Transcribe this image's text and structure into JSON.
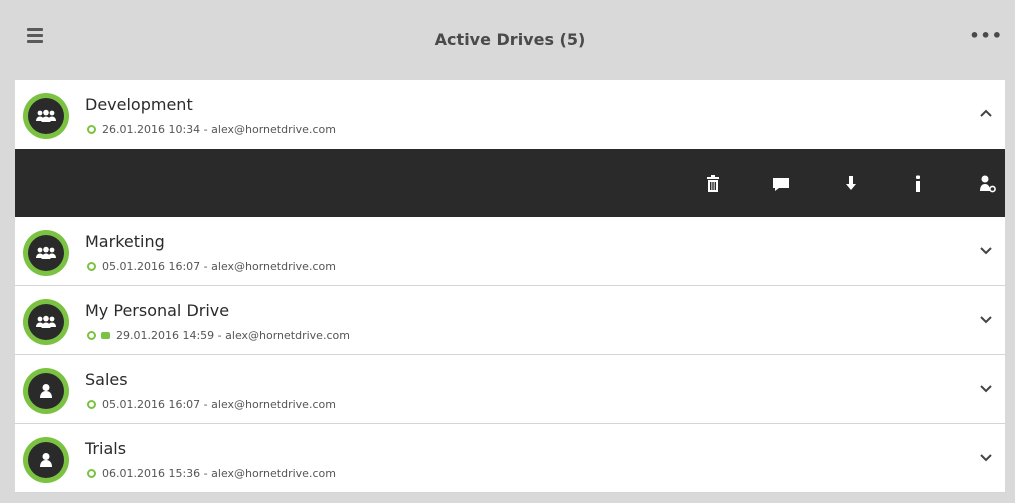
{
  "header": {
    "title": "Active Drives (5)",
    "menu_icon": "hamburger-icon",
    "more_label": "•••"
  },
  "colors": {
    "accent_green": "#7cc242",
    "toolbar_bg": "#2a2a2a",
    "header_bg": "#d9d9d9"
  },
  "drives": [
    {
      "name": "Development",
      "meta": "26.01.2016 10:34 - alex@hornetdrive.com",
      "icon": "group-icon",
      "expanded": true
    },
    {
      "name": "Marketing",
      "meta": "05.01.2016 16:07 - alex@hornetdrive.com",
      "icon": "group-icon",
      "expanded": false
    },
    {
      "name": "My Personal Drive",
      "meta": "29.01.2016 14:59 - alex@hornetdrive.com",
      "icon": "group-icon",
      "expanded": false,
      "has_chat": true
    },
    {
      "name": "Sales",
      "meta": "05.01.2016 16:07 - alex@hornetdrive.com",
      "icon": "user-icon",
      "expanded": false
    },
    {
      "name": "Trials",
      "meta": "06.01.2016 15:36 - alex@hornetdrive.com",
      "icon": "user-icon",
      "expanded": false
    }
  ],
  "toolbar": {
    "actions": [
      "trash-icon",
      "chat-icon",
      "download-icon",
      "info-icon",
      "user-settings-icon"
    ]
  }
}
